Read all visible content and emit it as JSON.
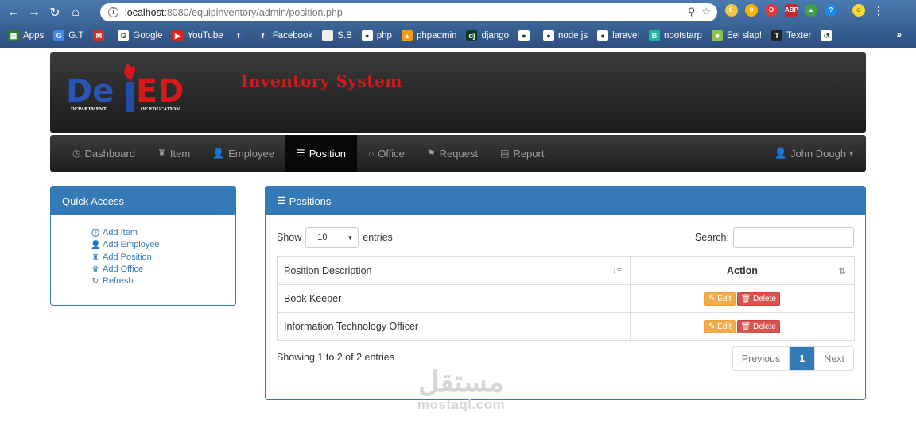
{
  "browser": {
    "url_host": "localhost:",
    "url_rest": "8080/equipinventory/admin/position.php",
    "bookmarks": [
      {
        "label": "Apps",
        "icon": "apps-icon",
        "color": "#2e7d32"
      },
      {
        "label": "G.T",
        "icon": "translate-icon",
        "color": "#4285f4"
      },
      {
        "label": "",
        "icon": "gmail-icon",
        "color": "#d93025"
      },
      {
        "label": "Google",
        "icon": "google-icon",
        "color": "#ffffff"
      },
      {
        "label": "YouTube",
        "icon": "youtube-icon",
        "color": "#e62117"
      },
      {
        "label": "",
        "icon": "facebook-icon",
        "color": "#3b5998"
      },
      {
        "label": "Facebook",
        "icon": "facebook-icon",
        "color": "#3b5998"
      },
      {
        "label": "S.B",
        "icon": "page-icon",
        "color": "#eeeeee"
      },
      {
        "label": "php",
        "icon": "globe-icon",
        "color": "#ffffff"
      },
      {
        "label": "phpadmin",
        "icon": "phpmyadmin-icon",
        "color": "#f89c0e"
      },
      {
        "label": "django",
        "icon": "django-icon",
        "color": "#0c3c26"
      },
      {
        "label": "",
        "icon": "globe-icon",
        "color": "#ffffff"
      },
      {
        "label": "node js",
        "icon": "globe-icon",
        "color": "#ffffff"
      },
      {
        "label": "laravel",
        "icon": "globe-icon",
        "color": "#ffffff"
      },
      {
        "label": "nootstarp",
        "icon": "bootstrap-icon",
        "color": "#1abc9c"
      },
      {
        "label": "Eel slap!",
        "icon": "eel-icon",
        "color": "#8bc34a"
      },
      {
        "label": "Texter",
        "icon": "texter-icon",
        "color": "#222222"
      },
      {
        "label": "",
        "icon": "history-icon",
        "color": "#ffffff"
      }
    ],
    "more": "»"
  },
  "header": {
    "logo_text": "DepED",
    "logo_left": "DEPARTMENT",
    "logo_right": "OF EDUCATION",
    "title": "Inventory System"
  },
  "nav": {
    "items": [
      {
        "label": "Dashboard",
        "icon": "dashboard-icon"
      },
      {
        "label": "Item",
        "icon": "item-icon"
      },
      {
        "label": "Employee",
        "icon": "user-icon"
      },
      {
        "label": "Position",
        "icon": "list-icon"
      },
      {
        "label": "Office",
        "icon": "home-icon"
      },
      {
        "label": "Request",
        "icon": "tags-icon"
      },
      {
        "label": "Report",
        "icon": "report-icon"
      }
    ],
    "active": "Position",
    "user": "John Dough"
  },
  "quick_access": {
    "title": "Quick Access",
    "items": [
      {
        "label": "Add Item",
        "icon": "plus-circle-icon"
      },
      {
        "label": "Add Employee",
        "icon": "user-icon"
      },
      {
        "label": "Add Position",
        "icon": "position-icon"
      },
      {
        "label": "Add Office",
        "icon": "office-icon"
      },
      {
        "label": "Refresh",
        "icon": "refresh-icon"
      }
    ]
  },
  "positions": {
    "title": "Positions",
    "show": "Show",
    "entries_value": "10",
    "entries": "entries",
    "search_label": "Search:",
    "columns": [
      "Position Description",
      "Action"
    ],
    "rows": [
      {
        "description": "Book Keeper"
      },
      {
        "description": "Information Technology Officer"
      }
    ],
    "edit_label": "Edit",
    "delete_label": "Delete",
    "info": "Showing 1 to 2 of 2 entries",
    "pager": {
      "previous": "Previous",
      "current": "1",
      "next": "Next"
    }
  },
  "watermark": {
    "arabic": "مستقل",
    "latin": "mostaql.com"
  },
  "colors": {
    "primary": "#337ab7",
    "title_red": "#d9181a",
    "edit": "#f0ad4e",
    "delete": "#d9534f"
  }
}
